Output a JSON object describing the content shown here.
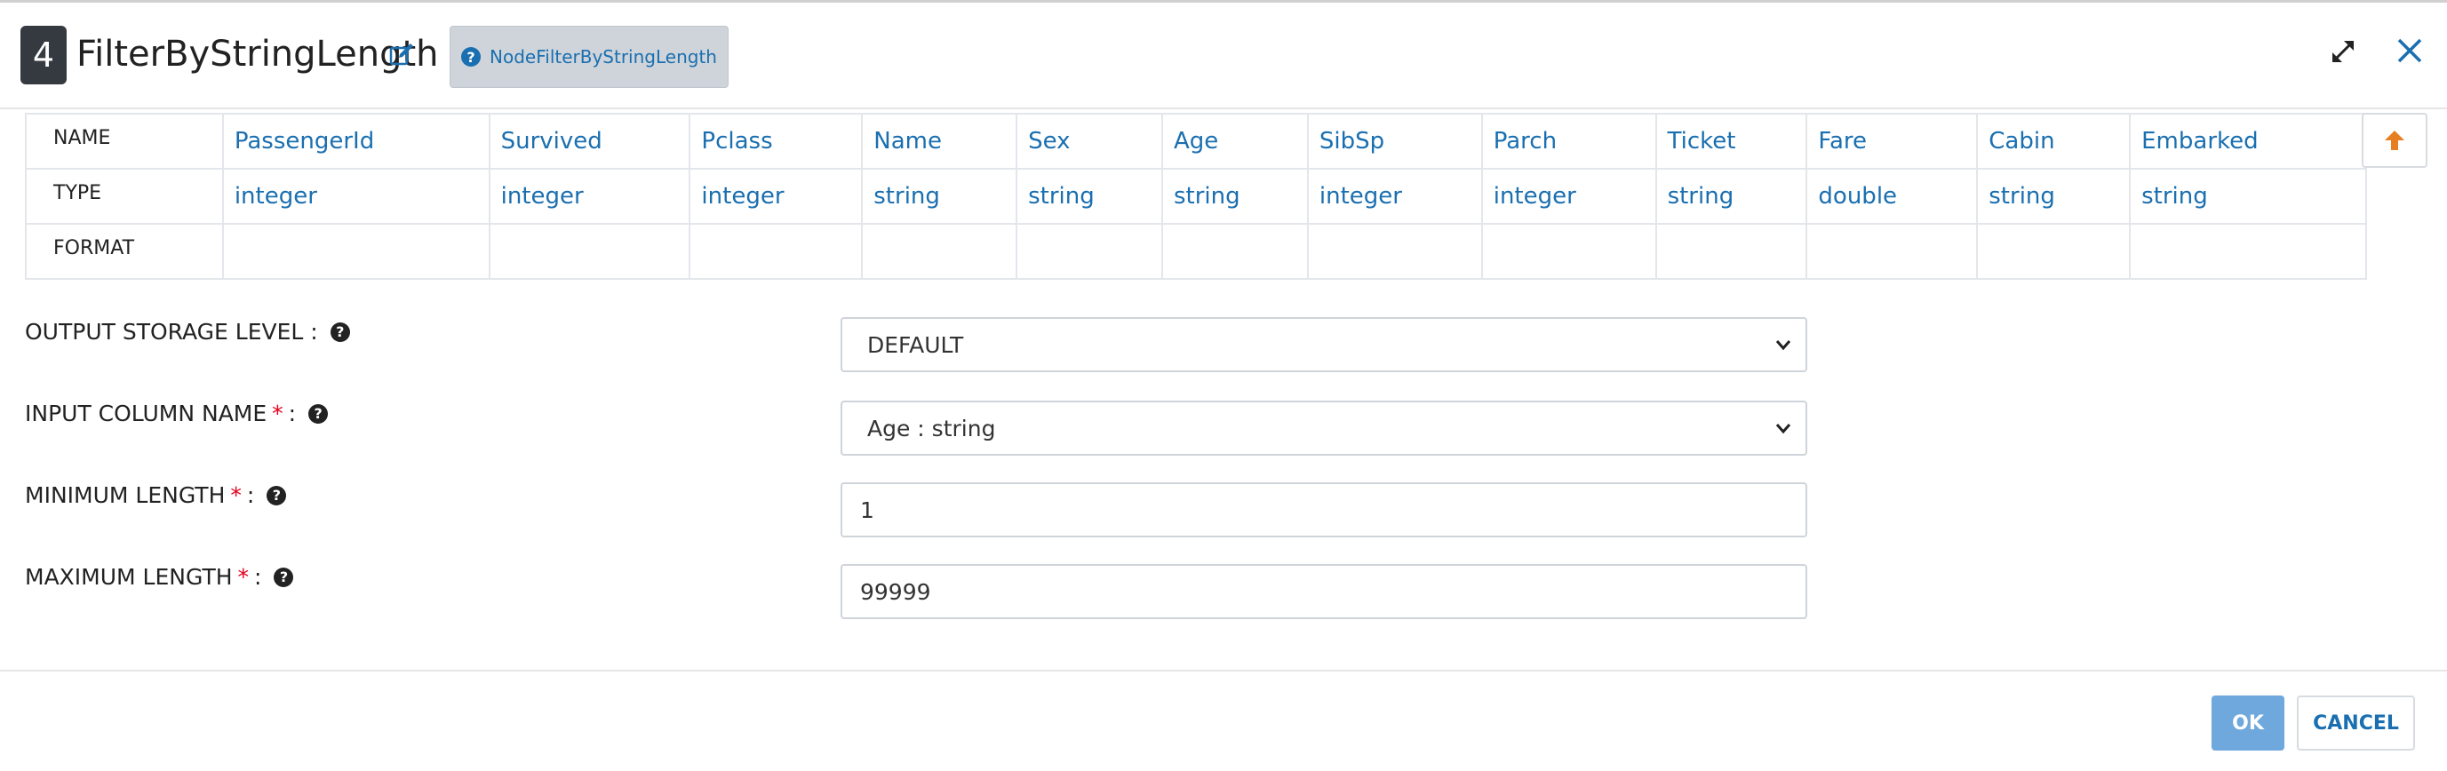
{
  "header": {
    "step_number": "4",
    "title": "FilterByStringLength",
    "node_button_label": "NodeFilterByStringLength",
    "icons": [
      "edit-icon",
      "help-circle-icon",
      "expand-icon",
      "close-icon"
    ]
  },
  "schema": {
    "row_labels": {
      "name": "NAME",
      "type": "TYPE",
      "format": "FORMAT"
    },
    "columns": [
      {
        "name": "PassengerId",
        "type": "integer",
        "format": ""
      },
      {
        "name": "Survived",
        "type": "integer",
        "format": ""
      },
      {
        "name": "Pclass",
        "type": "integer",
        "format": ""
      },
      {
        "name": "Name",
        "type": "string",
        "format": ""
      },
      {
        "name": "Sex",
        "type": "string",
        "format": ""
      },
      {
        "name": "Age",
        "type": "string",
        "format": ""
      },
      {
        "name": "SibSp",
        "type": "integer",
        "format": ""
      },
      {
        "name": "Parch",
        "type": "integer",
        "format": ""
      },
      {
        "name": "Ticket",
        "type": "string",
        "format": ""
      },
      {
        "name": "Fare",
        "type": "double",
        "format": ""
      },
      {
        "name": "Cabin",
        "type": "string",
        "format": ""
      },
      {
        "name": "Embarked",
        "type": "string",
        "format": ""
      }
    ]
  },
  "form": {
    "output_storage_level": {
      "label": "OUTPUT STORAGE LEVEL :",
      "value": "DEFAULT"
    },
    "input_column_name": {
      "label": "INPUT COLUMN NAME",
      "required_mark": "*",
      "suffix": ":",
      "value": "Age : string"
    },
    "minimum_length": {
      "label": "MINIMUM LENGTH",
      "required_mark": "*",
      "suffix": ":",
      "value": "1"
    },
    "maximum_length": {
      "label": "MAXIMUM LENGTH",
      "required_mark": "*",
      "suffix": ":",
      "value": "99999"
    }
  },
  "footer": {
    "ok_label": "OK",
    "cancel_label": "CANCEL"
  },
  "colors": {
    "accent": "#1a6fb0",
    "ok_button": "#6fa8dc",
    "badge": "#343a40",
    "required": "#e3001b",
    "arrow_up": "#e67e22"
  }
}
